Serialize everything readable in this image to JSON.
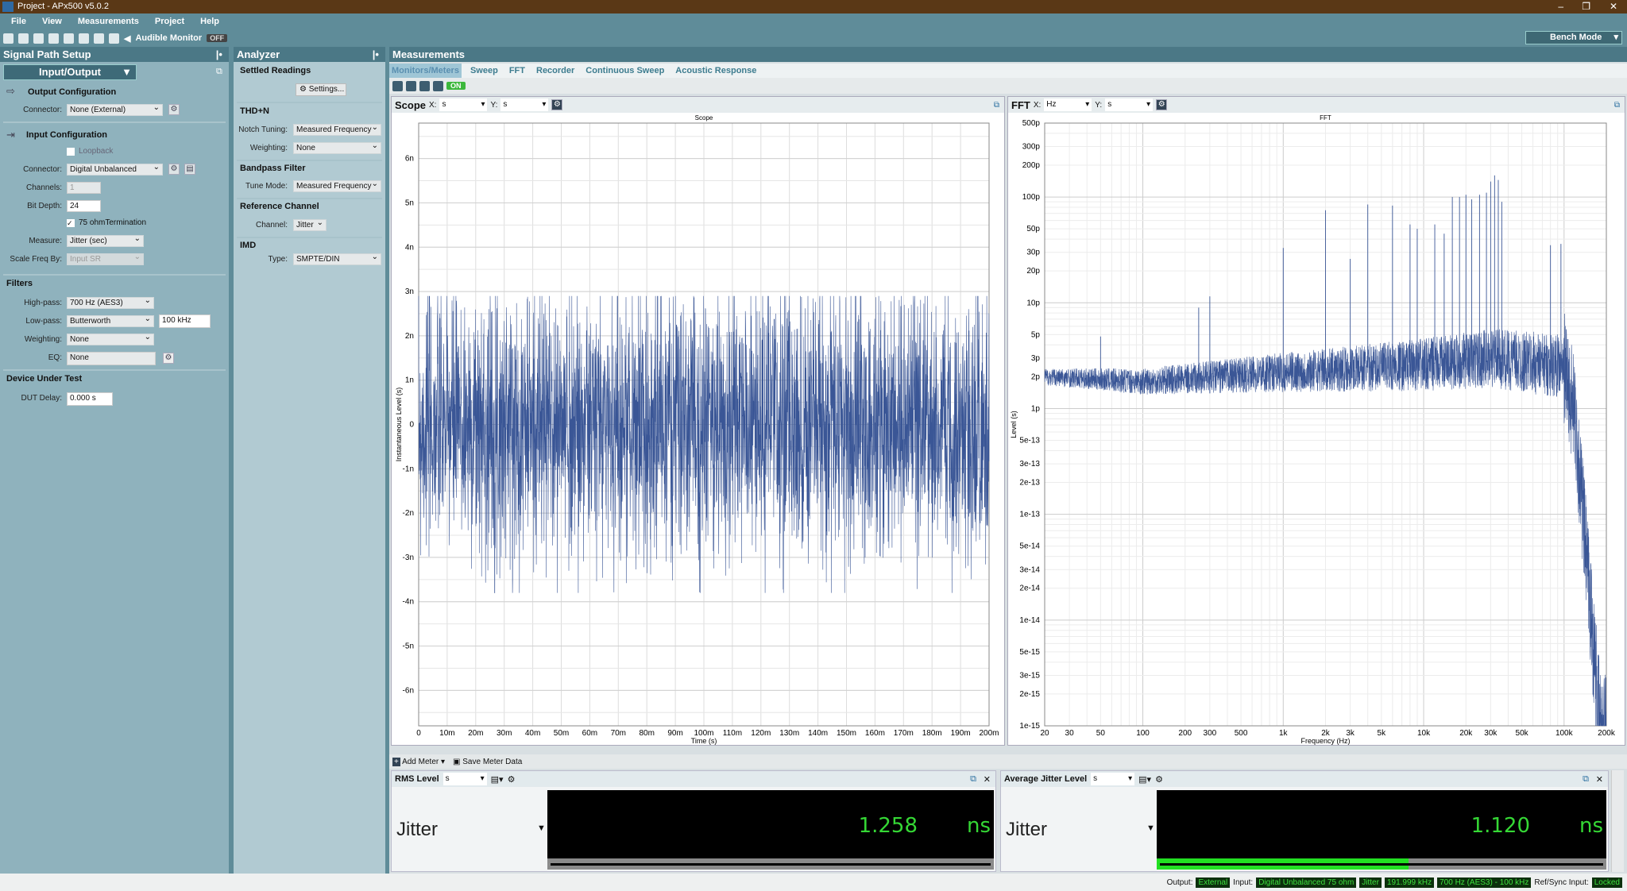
{
  "window": {
    "title": "Project - APx500 v5.0.2",
    "min": "–",
    "restore": "❐",
    "close": "✕"
  },
  "menu": [
    "File",
    "View",
    "Measurements",
    "Project",
    "Help"
  ],
  "toolbar": {
    "audible_monitor": "Audible Monitor",
    "audible_state": "OFF",
    "mode": "Bench Mode"
  },
  "signal_path": {
    "title": "Signal Path Setup",
    "selector": "Input/Output",
    "output": {
      "title": "Output Configuration",
      "connector_label": "Connector:",
      "connector": "None (External)"
    },
    "input": {
      "title": "Input Configuration",
      "loopback": "Loopback",
      "connector_label": "Connector:",
      "connector": "Digital Unbalanced",
      "channels_label": "Channels:",
      "channels": "1",
      "bitdepth_label": "Bit Depth:",
      "bitdepth": "24",
      "termination": "75 ohmTermination",
      "measure_label": "Measure:",
      "measure": "Jitter (sec)",
      "scale_label": "Scale Freq By:",
      "scale": "Input SR"
    },
    "filters": {
      "title": "Filters",
      "hp_label": "High-pass:",
      "hp": "700 Hz (AES3)",
      "lp_label": "Low-pass:",
      "lp": "Butterworth",
      "lp_freq": "100 kHz",
      "w_label": "Weighting:",
      "w": "None",
      "eq_label": "EQ:",
      "eq": "None"
    },
    "dut": {
      "title": "Device Under Test",
      "delay_label": "DUT Delay:",
      "delay": "0.000 s"
    }
  },
  "analyzer": {
    "title": "Analyzer",
    "settled": "Settled Readings",
    "settings": "Settings...",
    "thdn": "THD+N",
    "notch_label": "Notch Tuning:",
    "notch": "Measured Frequency",
    "weight_label": "Weighting:",
    "weight": "None",
    "bandpass": "Bandpass Filter",
    "tune_label": "Tune Mode:",
    "tune": "Measured Frequency",
    "ref": "Reference Channel",
    "chan_label": "Channel:",
    "chan": "Jitter",
    "imd": "IMD",
    "type_label": "Type:",
    "type": "SMPTE/DIN"
  },
  "measurements": {
    "title": "Measurements",
    "tabs": [
      "Monitors/Meters",
      "Sweep",
      "FFT",
      "Recorder",
      "Continuous Sweep",
      "Acoustic Response"
    ],
    "on": "ON"
  },
  "scope": {
    "name": "Scope",
    "x_label": "X:",
    "x_unit": "s",
    "y_label": "Y:",
    "y_unit": "s"
  },
  "fft": {
    "name": "FFT",
    "x_label": "X:",
    "x_unit": "Hz",
    "y_label": "Y:",
    "y_unit": "s"
  },
  "meters": {
    "add": "Add Meter",
    "save": "Save Meter Data",
    "items": [
      {
        "title": "RMS Level",
        "unit_sel": "s",
        "channel": "Jitter",
        "value": "1.258",
        "unit": "ns",
        "bar_fraction": 0
      },
      {
        "title": "Average Jitter Level",
        "unit_sel": "s",
        "channel": "Jitter",
        "value": "1.120",
        "unit": "ns",
        "bar_fraction": 0.56
      }
    ]
  },
  "status": {
    "output_label": "Output:",
    "output": "External",
    "input_label": "Input:",
    "input": "Digital Unbalanced 75 ohm",
    "measure": "Jitter",
    "rate": "191.999 kHz",
    "filter": "700 Hz (AES3) - 100 kHz",
    "ref_label": "Ref/Sync Input:",
    "ref": "Locked"
  },
  "colors": {
    "trace": "#3a5696",
    "meter_text": "#35d835",
    "meter_bar": "#22e022"
  },
  "chart_data": [
    {
      "type": "line",
      "title": "Scope",
      "xlabel": "Time (s)",
      "ylabel": "Instantaneous Level (s)",
      "xlim": [
        0,
        0.2
      ],
      "ylim": [
        -6.8e-09,
        6.8e-09
      ],
      "grid": true,
      "xticks": [
        "0",
        "10m",
        "20m",
        "30m",
        "40m",
        "50m",
        "60m",
        "70m",
        "80m",
        "90m",
        "100m",
        "110m",
        "120m",
        "130m",
        "140m",
        "150m",
        "160m",
        "170m",
        "180m",
        "190m",
        "200m"
      ],
      "yticks": [
        {
          "v": 6e-09,
          "l": "6n"
        },
        {
          "v": 5e-09,
          "l": "5n"
        },
        {
          "v": 4e-09,
          "l": "4n"
        },
        {
          "v": 3e-09,
          "l": "3n"
        },
        {
          "v": 2e-09,
          "l": "2n"
        },
        {
          "v": 1e-09,
          "l": "1n"
        },
        {
          "v": 0,
          "l": "0"
        },
        {
          "v": -1e-09,
          "l": "-1n"
        },
        {
          "v": -2e-09,
          "l": "-2n"
        },
        {
          "v": -3e-09,
          "l": "-3n"
        },
        {
          "v": -4e-09,
          "l": "-4n"
        },
        {
          "v": -5e-09,
          "l": "-5n"
        },
        {
          "v": -6e-09,
          "l": "-6n"
        }
      ],
      "series": [
        {
          "description_values": {
            "rms": 1.258e-09,
            "max": 2.9e-09,
            "min": -3.8e-09
          }
        }
      ]
    },
    {
      "type": "line",
      "title": "FFT",
      "xlabel": "Frequency (Hz)",
      "ylabel": "Level (s)",
      "xscale": "log",
      "yscale": "log",
      "xlim": [
        20,
        200000
      ],
      "ylim": [
        1e-15,
        5e-10
      ],
      "grid": true,
      "xticks": [
        {
          "v": 20,
          "l": "20"
        },
        {
          "v": 30,
          "l": "30"
        },
        {
          "v": 50,
          "l": "50"
        },
        {
          "v": 100,
          "l": "100"
        },
        {
          "v": 200,
          "l": "200"
        },
        {
          "v": 300,
          "l": "300"
        },
        {
          "v": 500,
          "l": "500"
        },
        {
          "v": 1000,
          "l": "1k"
        },
        {
          "v": 2000,
          "l": "2k"
        },
        {
          "v": 3000,
          "l": "3k"
        },
        {
          "v": 5000,
          "l": "5k"
        },
        {
          "v": 10000,
          "l": "10k"
        },
        {
          "v": 20000,
          "l": "20k"
        },
        {
          "v": 30000,
          "l": "30k"
        },
        {
          "v": 50000,
          "l": "50k"
        },
        {
          "v": 100000,
          "l": "100k"
        },
        {
          "v": 200000,
          "l": "200k"
        }
      ],
      "yticks": [
        {
          "v": 5e-10,
          "l": "500p"
        },
        {
          "v": 3e-10,
          "l": "300p"
        },
        {
          "v": 2e-10,
          "l": "200p"
        },
        {
          "v": 1e-10,
          "l": "100p"
        },
        {
          "v": 5e-11,
          "l": "50p"
        },
        {
          "v": 3e-11,
          "l": "30p"
        },
        {
          "v": 2e-11,
          "l": "20p"
        },
        {
          "v": 1e-11,
          "l": "10p"
        },
        {
          "v": 5e-12,
          "l": "5p"
        },
        {
          "v": 3e-12,
          "l": "3p"
        },
        {
          "v": 2e-12,
          "l": "2p"
        },
        {
          "v": 1e-12,
          "l": "1p"
        },
        {
          "v": 5e-13,
          "l": "5e-13"
        },
        {
          "v": 3e-13,
          "l": "3e-13"
        },
        {
          "v": 2e-13,
          "l": "2e-13"
        },
        {
          "v": 1e-13,
          "l": "1e-13"
        },
        {
          "v": 5e-14,
          "l": "5e-14"
        },
        {
          "v": 3e-14,
          "l": "3e-14"
        },
        {
          "v": 2e-14,
          "l": "2e-14"
        },
        {
          "v": 1e-14,
          "l": "1e-14"
        },
        {
          "v": 5e-15,
          "l": "5e-15"
        },
        {
          "v": 3e-15,
          "l": "3e-15"
        },
        {
          "v": 2e-15,
          "l": "2e-15"
        },
        {
          "v": 1e-15,
          "l": "1e-15"
        }
      ],
      "baseline": [
        [
          20,
          2e-12
        ],
        [
          100,
          1.8e-12
        ],
        [
          1000,
          2.2e-12
        ],
        [
          10000,
          2.6e-12
        ],
        [
          30000,
          3e-12
        ],
        [
          100000,
          2.5e-12
        ],
        [
          120000,
          8e-13
        ],
        [
          150000,
          2e-14
        ],
        [
          180000,
          1e-15
        ]
      ],
      "peaks": [
        [
          50,
          4.8e-12
        ],
        [
          250,
          9e-12
        ],
        [
          300,
          1.15e-11
        ],
        [
          1000,
          3.3e-11
        ],
        [
          2000,
          7.5e-11
        ],
        [
          3000,
          2.6e-11
        ],
        [
          4000,
          8.5e-11
        ],
        [
          6000,
          8.3e-11
        ],
        [
          8000,
          5.5e-11
        ],
        [
          9000,
          5e-11
        ],
        [
          12000,
          5.5e-11
        ],
        [
          14000,
          4.5e-11
        ],
        [
          16000,
          1e-10
        ],
        [
          18000,
          1e-10
        ],
        [
          20000,
          1.05e-10
        ],
        [
          22000,
          9.5e-11
        ],
        [
          25000,
          1.05e-10
        ],
        [
          28000,
          1.1e-10
        ],
        [
          30000,
          1.4e-10
        ],
        [
          32000,
          1.6e-10
        ],
        [
          34000,
          1.45e-10
        ],
        [
          36000,
          9e-11
        ],
        [
          80000,
          3.5e-11
        ],
        [
          95000,
          3.6e-11
        ]
      ]
    }
  ]
}
